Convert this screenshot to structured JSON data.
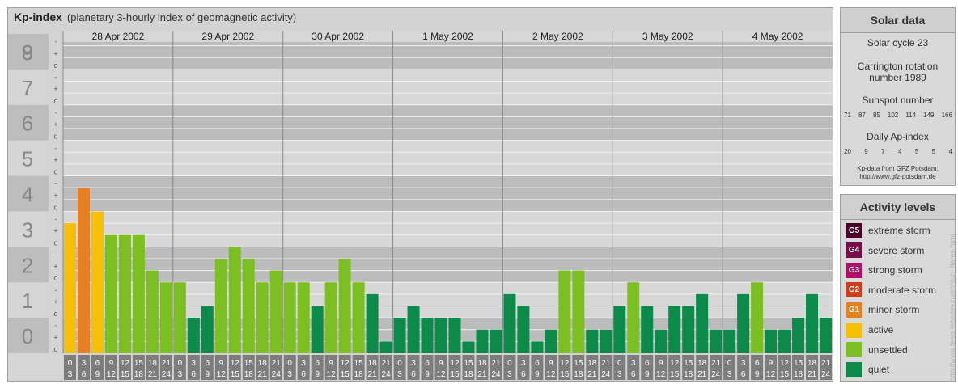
{
  "header": {
    "title": "Kp-index",
    "subtitle": "(planetary 3-hourly index of geomagnetic activity)"
  },
  "chart_data": {
    "type": "bar",
    "title": "Kp-index",
    "subtitle": "(planetary 3-hourly index of geomagnetic activity)",
    "ylim": [
      0,
      9
    ],
    "y_ticks": [
      "0",
      "1",
      "2",
      "3",
      "4",
      "5",
      "6",
      "7",
      "8",
      "9"
    ],
    "minor_marks": [
      "o",
      "+",
      "-"
    ],
    "days": [
      "28 Apr 2002",
      "29 Apr 2002",
      "30 Apr 2002",
      "1 May 2002",
      "2 May 2002",
      "3 May 2002",
      "4 May 2002"
    ],
    "slot_labels": [
      [
        "0",
        "3"
      ],
      [
        "3",
        "6"
      ],
      [
        "6",
        "9"
      ],
      [
        "9",
        "12"
      ],
      [
        "12",
        "15"
      ],
      [
        "15",
        "18"
      ],
      [
        "18",
        "21"
      ],
      [
        "21",
        "24"
      ]
    ],
    "values": [
      3.667,
      4.667,
      4.0,
      3.333,
      3.333,
      3.333,
      2.333,
      2.0,
      2.0,
      1.0,
      1.333,
      2.667,
      3.0,
      2.667,
      2.0,
      2.333,
      2.0,
      2.0,
      1.333,
      2.0,
      2.667,
      2.0,
      1.667,
      0.333,
      1.0,
      1.333,
      1.0,
      1.0,
      1.0,
      0.333,
      0.667,
      0.667,
      1.667,
      1.333,
      0.333,
      0.667,
      2.333,
      2.333,
      0.667,
      0.667,
      1.333,
      2.0,
      1.333,
      0.667,
      1.333,
      1.333,
      1.667,
      0.667,
      0.667,
      1.667,
      2.0,
      0.667,
      0.667,
      1.0,
      1.667,
      1.0
    ],
    "colors": {
      "quiet": "#0b8a4a",
      "unsettled": "#7cbf22",
      "active": "#f7c008",
      "minor_storm": "#e67e22",
      "moderate_storm": "#d13a1a",
      "strong_storm": "#b00e6a",
      "severe_storm": "#7a0a4c",
      "extreme_storm": "#4a0027",
      "band_dark": "#bcbcbc",
      "band_light": "#d7d7d7",
      "ylabel_dark": "#bdbdbd",
      "ylabel_light": "#d5d5d5",
      "slot_box": "#7d7d7d"
    }
  },
  "solar": {
    "title": "Solar data",
    "cycle": "Solar cycle 23",
    "carrington_1": "Carrington rotation",
    "carrington_2": "number 1989",
    "sunspot_label": "Sunspot number",
    "sunspots": [
      "71",
      "87",
      "85",
      "102",
      "114",
      "149",
      "166"
    ],
    "ap_label": "Daily Ap-index",
    "ap": [
      "20",
      "9",
      "7",
      "4",
      "5",
      "5",
      "4"
    ],
    "source_1": "Kp-data from GFZ Potsdam:",
    "source_2": "http://www.gfz-potsdam.de"
  },
  "activity": {
    "title": "Activity levels",
    "levels": [
      {
        "code": "G5",
        "label": "extreme storm",
        "color": "#4a0027"
      },
      {
        "code": "G4",
        "label": "severe storm",
        "color": "#7a0a4c"
      },
      {
        "code": "G3",
        "label": "strong storm",
        "color": "#b00e6a"
      },
      {
        "code": "G2",
        "label": "moderate storm",
        "color": "#d13a1a"
      },
      {
        "code": "G1",
        "label": "minor storm",
        "color": "#e67e22"
      },
      {
        "code": "",
        "label": "active",
        "color": "#f7c008"
      },
      {
        "code": "",
        "label": "unsettled",
        "color": "#7cbf22"
      },
      {
        "code": "",
        "label": "quiet",
        "color": "#0b8a4a"
      }
    ]
  },
  "credit": "http://www.tesis.lebedev.ru/en/sun_flares.html"
}
